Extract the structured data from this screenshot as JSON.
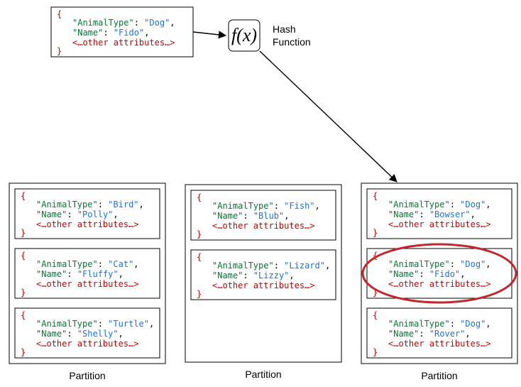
{
  "chart_data": {
    "type": "diagram",
    "title": "",
    "input_document": {
      "AnimalType": "Dog",
      "Name": "Fido",
      "other": "…other attributes…"
    },
    "hash_function_label": "f(x)",
    "hash_caption": "Hash Function",
    "partition_label": "Partition",
    "partitions": [
      {
        "documents": [
          {
            "AnimalType": "Bird",
            "Name": "Polly",
            "other": "…other attributes…"
          },
          {
            "AnimalType": "Cat",
            "Name": "Fluffy",
            "other": "…other attributes…"
          },
          {
            "AnimalType": "Turtle",
            "Name": "Shelly",
            "other": "…other attributes…"
          }
        ]
      },
      {
        "documents": [
          {
            "AnimalType": "Fish",
            "Name": "Blub",
            "other": "…other attributes…"
          },
          {
            "AnimalType": "Lizard",
            "Name": "Lizzy",
            "other": "…other attributes…"
          }
        ]
      },
      {
        "documents": [
          {
            "AnimalType": "Dog",
            "Name": "Bowser",
            "other": "…other attributes…"
          },
          {
            "AnimalType": "Dog",
            "Name": "Fido",
            "other": "…other attributes…",
            "highlight": true
          },
          {
            "AnimalType": "Dog",
            "Name": "Rover",
            "other": "…other attributes…"
          }
        ]
      }
    ]
  },
  "colors": {
    "brace": "#cc0000",
    "key": "#007a33",
    "value": "#1a73e8",
    "other": "#cc0000",
    "ellipse": "#c1272d"
  }
}
